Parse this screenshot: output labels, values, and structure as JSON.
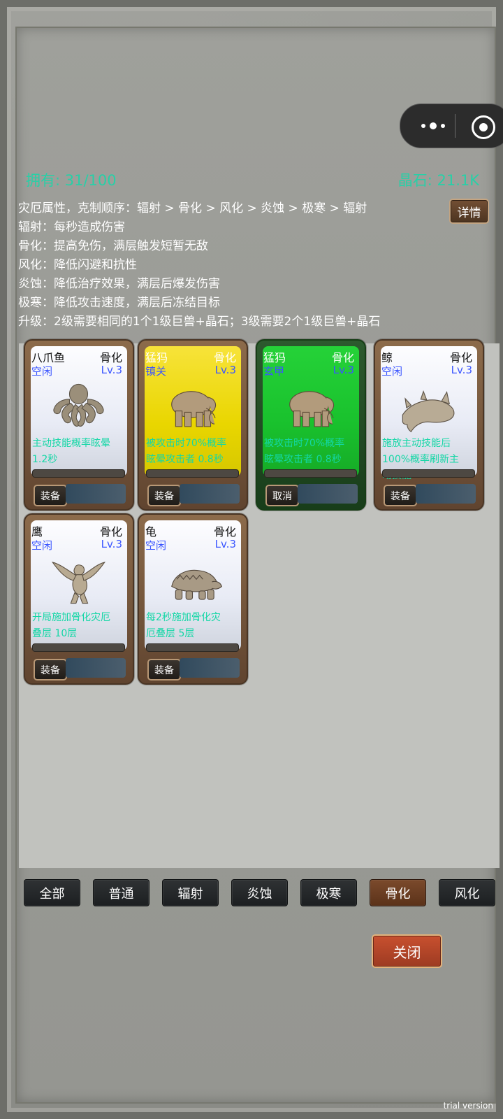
{
  "header": {
    "owned": "拥有: 31/100",
    "gems": "晶石: 21.1K"
  },
  "info": {
    "lines": [
      "灾厄属性，克制顺序：辐射 > 骨化 > 风化 > 炎蚀 > 极寒 > 辐射",
      "辐射：每秒造成伤害",
      "骨化：提高免伤，满层触发短暂无敌",
      "风化：降低闪避和抗性",
      "炎蚀：降低治疗效果，满层后爆发伤害",
      "极寒：降低攻击速度，满层后冻结目标",
      "升级：2级需要相同的1个1级巨兽+晶石；3级需要2个1级巨兽+晶石"
    ],
    "detail_button": "详情"
  },
  "cards": [
    {
      "name": "八爪鱼",
      "type": "骨化",
      "status": "空闲",
      "level": "Lv.3",
      "desc1": "主动技能概率眩晕",
      "desc2": "1.2秒",
      "button": "装备",
      "theme": "white",
      "icon": "octopus-icon"
    },
    {
      "name": "猛犸",
      "type": "骨化",
      "status": "镇关",
      "level": "Lv.3",
      "desc1": "被攻击时70%概率",
      "desc2": "眩晕攻击者 0.8秒",
      "button": "装备",
      "theme": "yellow",
      "icon": "mammoth-icon"
    },
    {
      "name": "猛犸",
      "type": "骨化",
      "status": "玄甲",
      "level": "Lv.3",
      "desc1": "被攻击时70%概率",
      "desc2": "眩晕攻击者 0.8秒",
      "button": "取消",
      "theme": "green",
      "icon": "mammoth-icon"
    },
    {
      "name": "鲸",
      "type": "骨化",
      "status": "空闲",
      "level": "Lv.3",
      "desc1": "施放主动技能后",
      "desc2": "100%概率刷新主",
      "desc3": "动技能",
      "button": "装备",
      "theme": "white",
      "icon": "whale-icon"
    },
    {
      "name": "鹰",
      "type": "骨化",
      "status": "空闲",
      "level": "Lv.3",
      "desc1": "开局施加骨化灾厄",
      "desc2": "叠层 10层",
      "button": "装备",
      "theme": "white",
      "icon": "eagle-icon"
    },
    {
      "name": "龟",
      "type": "骨化",
      "status": "空闲",
      "level": "Lv.3",
      "desc1": "每2秒施加骨化灾",
      "desc2": "厄叠层 5层",
      "button": "装备",
      "theme": "white",
      "icon": "turtle-icon"
    }
  ],
  "filters": [
    "全部",
    "普通",
    "辐射",
    "炎蚀",
    "极寒",
    "骨化",
    "风化"
  ],
  "active_filter": "骨化",
  "close_button": "关闭",
  "watermark": "trial version",
  "colors": {
    "accent": "#27d0a7",
    "blue": "#3b56ff",
    "active_tab": "#6a3a21",
    "close_button": "#b34429"
  }
}
